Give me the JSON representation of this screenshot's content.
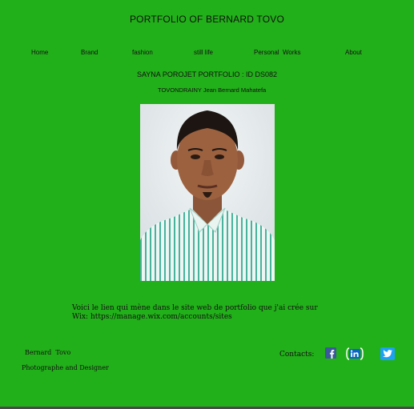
{
  "header": {
    "title": "PORTFOLIO OF BERNARD TOVO"
  },
  "nav": {
    "items": [
      {
        "label": "Home"
      },
      {
        "label": "Brand"
      },
      {
        "label": "fashion"
      },
      {
        "label": "still life"
      },
      {
        "label": "Personal  Works"
      },
      {
        "label": "About"
      }
    ]
  },
  "main": {
    "subtitle": "SAYNA POROJET PORTFOLIO : ID DS082",
    "author": "TOVONDRAINY Jean Bernard Mahatefa",
    "description_line1": "Voici le lien  qui mène dans le site web de portfolio que j'ai crée sur",
    "description_line2": "Wix: https://manage.wix.com/accounts/sites"
  },
  "footer": {
    "name": "Bernard  Tovo",
    "role": "Photographe and Designer",
    "contacts_label": "Contacts:",
    "social": [
      {
        "icon": "facebook-icon",
        "color": "#3b5998"
      },
      {
        "icon": "linkedin-icon",
        "color": "#0a66c2"
      },
      {
        "icon": "twitter-icon",
        "color": "#1da1f2"
      }
    ]
  },
  "colors": {
    "background": "#22b01a",
    "text": "#111111"
  }
}
